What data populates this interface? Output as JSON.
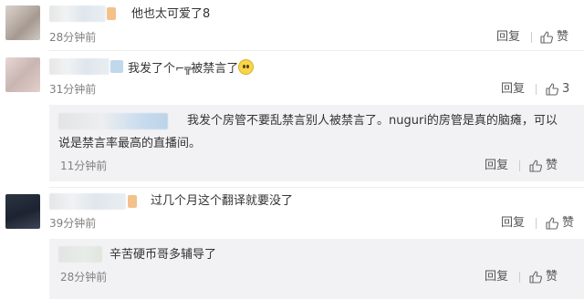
{
  "comments": [
    {
      "text": "他也太可爱了8",
      "time": "28分钟前",
      "reply": "回复",
      "like": "赞"
    },
    {
      "text_before": "我发了个",
      "icon": "gun-icon",
      "text_after": "被禁言了",
      "time": "31分钟前",
      "reply": "回复",
      "like_count": "3",
      "sub_reply": {
        "text_line1": "我发个房管不要乱禁言别人被禁言了。nuguri的房管是真的脑瘫，可以",
        "text_line2": "说是禁言率最高的直播间。",
        "time": "11分钟前",
        "reply": "回复",
        "like": "赞"
      }
    },
    {
      "text": "过几个月这个翻译就要没了",
      "time": "39分钟前",
      "reply": "回复",
      "like": "赞",
      "sub_reply": {
        "text": "辛苦硬币哥多辅导了",
        "time": "28分钟前",
        "reply": "回复",
        "like": "赞"
      }
    }
  ],
  "colors": {
    "text": "#333333",
    "meta": "#808080",
    "subbox_bg": "#f2f2f5"
  }
}
